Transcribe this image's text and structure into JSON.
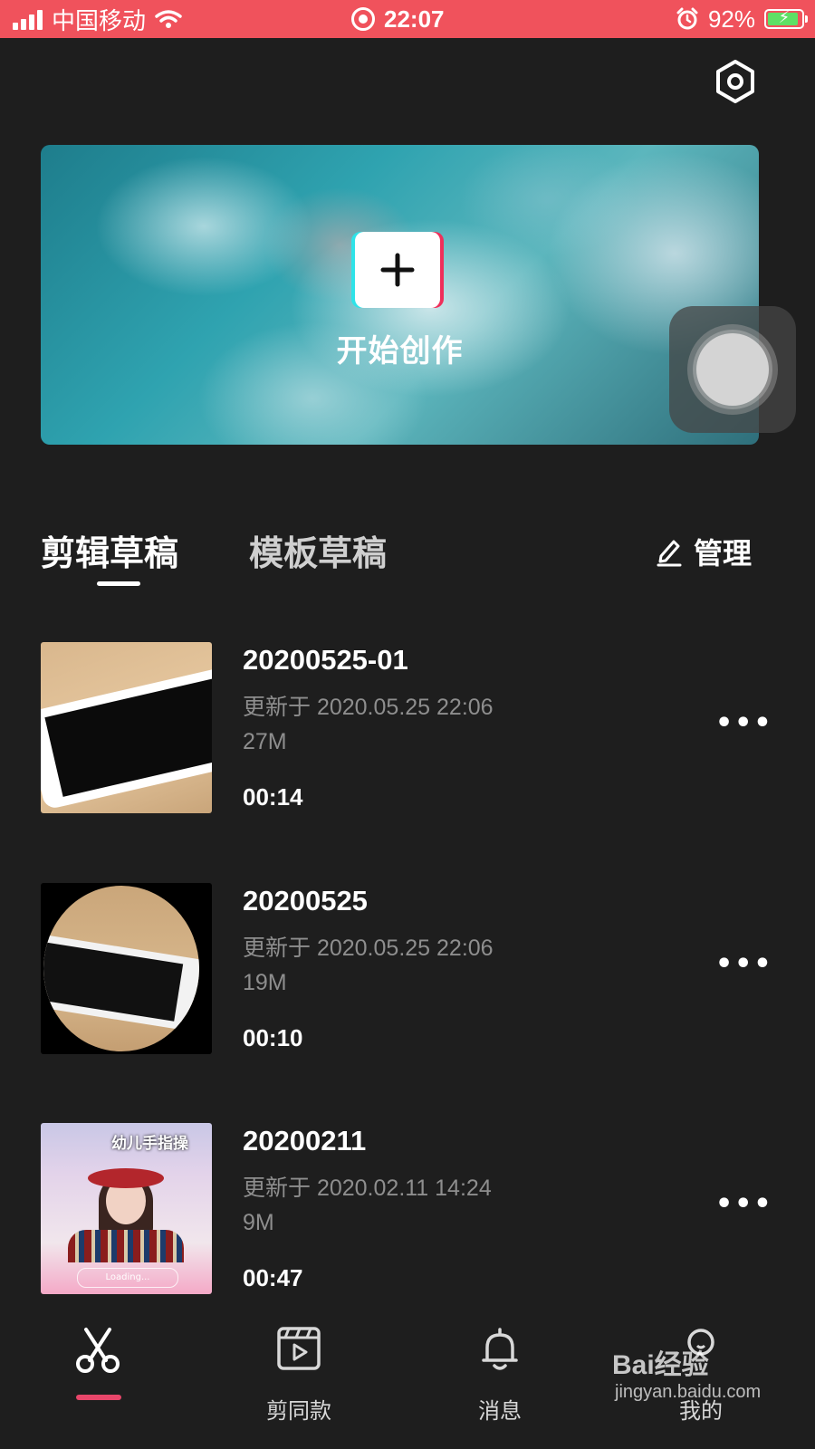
{
  "status_bar": {
    "carrier": "中国移动",
    "time": "22:07",
    "battery_percent": "92%",
    "battery_level": 0.92,
    "accent_color": "#f0525c"
  },
  "header": {
    "settings_icon": "gear-hexagon-icon"
  },
  "banner": {
    "label": "开始创作",
    "icon": "plus-icon"
  },
  "tabs": {
    "edit_drafts": "剪辑草稿",
    "template_drafts": "模板草稿",
    "manage_label": "管理",
    "manage_icon": "pencil-icon"
  },
  "drafts": [
    {
      "title": "20200525-01",
      "updated": "更新于 2020.05.25 22:06",
      "size": "27M",
      "duration": "00:14"
    },
    {
      "title": "20200525",
      "updated": "更新于 2020.05.25 22:06",
      "size": "19M",
      "duration": "00:10"
    },
    {
      "title": "20200211",
      "updated": "更新于 2020.02.11 14:24",
      "size": "9M",
      "duration": "00:47",
      "thumb_caption": "幼儿手指操",
      "thumb_loading": "Loading..."
    }
  ],
  "more_label": "•••",
  "bottom_nav": {
    "items": [
      {
        "label": "",
        "icon": "scissors-icon",
        "active": true
      },
      {
        "label": "剪同款",
        "icon": "clapperboard-play-icon"
      },
      {
        "label": "消息",
        "icon": "bell-icon"
      },
      {
        "label": "我的",
        "icon": "profile-icon"
      }
    ],
    "active_color": "#e8466a"
  },
  "watermark": {
    "brand": "Bai经验",
    "url": "jingyan.baidu.com"
  }
}
